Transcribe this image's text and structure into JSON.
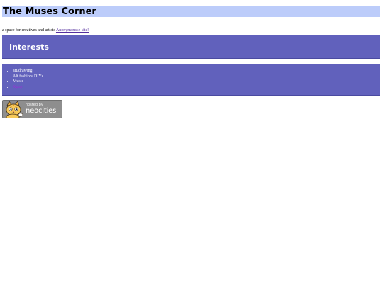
{
  "site": {
    "title": "The Muses Corner",
    "tagline": "a space for creatives and artists ",
    "tagline_link": "Anonymousse site!"
  },
  "interests": {
    "heading": "Interests",
    "items": [
      "art/drawing",
      "Alt fashion/ DIYs",
      "Music"
    ],
    "link_item": "Kpop"
  },
  "badge": {
    "hosted_text": "hosted by",
    "brand_text": "neocities",
    "icon": "neocities-cat-icon"
  },
  "colors": {
    "title_bar": "#bcccfa",
    "panel": "#6161bc",
    "link": "#55309e",
    "visited_link": "#9b30d6"
  }
}
